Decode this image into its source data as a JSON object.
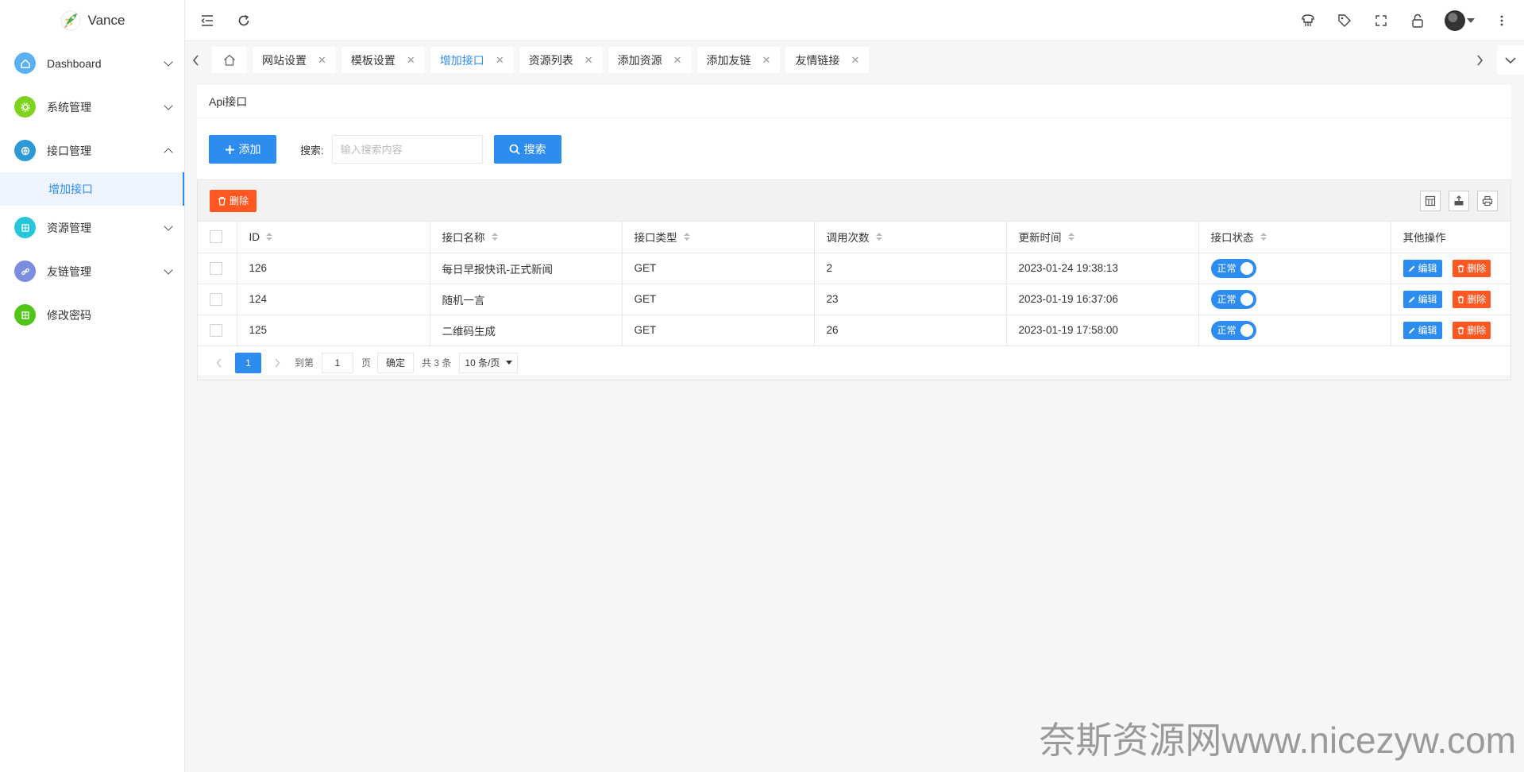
{
  "brand": {
    "name": "Vance"
  },
  "sidebar": {
    "items": [
      {
        "label": "Dashboard",
        "color": "#5ab0f5",
        "caret": "down"
      },
      {
        "label": "系统管理",
        "color": "#7ed321",
        "caret": "down"
      },
      {
        "label": "接口管理",
        "color": "#2d9ad6",
        "caret": "up"
      },
      {
        "label": "资源管理",
        "color": "#26c6da",
        "caret": "down"
      },
      {
        "label": "友链管理",
        "color": "#7b8de0",
        "caret": "down"
      },
      {
        "label": "修改密码",
        "color": "#52c41a",
        "caret": ""
      }
    ],
    "submenu_active": "增加接口"
  },
  "tabs": [
    {
      "label": "网站设置"
    },
    {
      "label": "模板设置"
    },
    {
      "label": "增加接口",
      "active": true
    },
    {
      "label": "资源列表"
    },
    {
      "label": "添加资源"
    },
    {
      "label": "添加友链"
    },
    {
      "label": "友情链接"
    }
  ],
  "card": {
    "title": "Api接口",
    "add_label": "添加",
    "search_label": "搜索:",
    "search_placeholder": "输入搜索内容",
    "search_button": "搜索"
  },
  "toolbar": {
    "delete_label": "删除"
  },
  "table": {
    "columns": [
      "ID",
      "接口名称",
      "接口类型",
      "调用次数",
      "更新时间",
      "接口状态",
      "其他操作"
    ],
    "rows": [
      {
        "id": "126",
        "name": "每日早报快讯-正式新闻",
        "type": "GET",
        "calls": "2",
        "updated": "2023-01-24 19:38:13",
        "status": "正常"
      },
      {
        "id": "124",
        "name": "随机一言",
        "type": "GET",
        "calls": "23",
        "updated": "2023-01-19 16:37:06",
        "status": "正常"
      },
      {
        "id": "125",
        "name": "二维码生成",
        "type": "GET",
        "calls": "26",
        "updated": "2023-01-19 17:58:00",
        "status": "正常"
      }
    ],
    "edit_label": "编辑",
    "delete_label": "删除"
  },
  "pager": {
    "current": "1",
    "goto_label": "到第",
    "goto_value": "1",
    "page_unit": "页",
    "confirm": "确定",
    "total": "共 3 条",
    "page_size": "10 条/页"
  },
  "watermark": "奈斯资源网www.nicezyw.com"
}
